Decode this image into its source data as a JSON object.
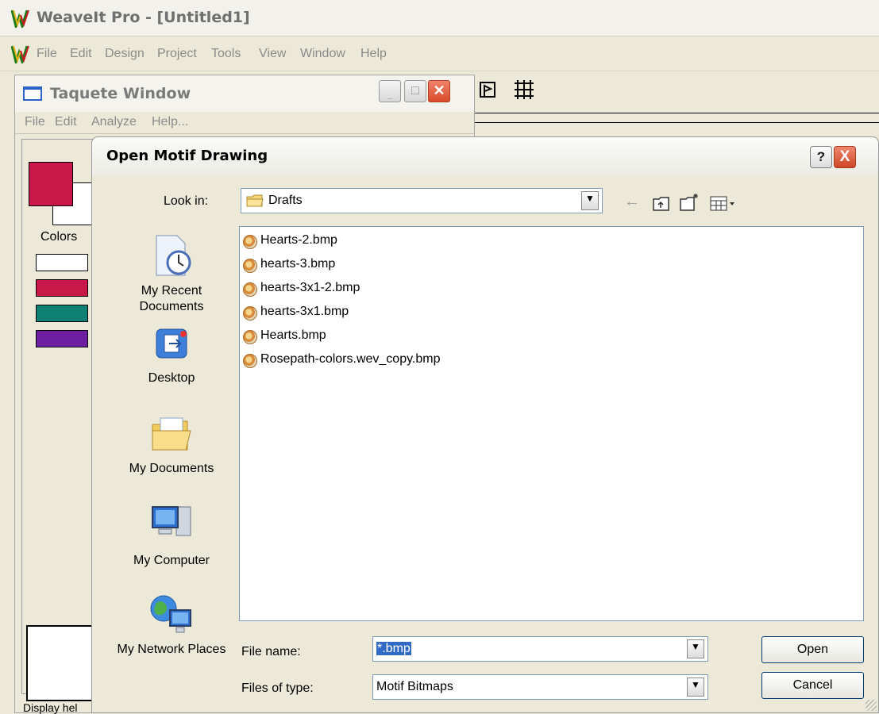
{
  "app": {
    "title": "WeaveIt Pro - [Untitled1]",
    "menu": [
      "File",
      "Edit",
      "Design",
      "Project",
      "Tools",
      "View",
      "Window",
      "Help"
    ]
  },
  "taquete": {
    "title": "Taquete Window",
    "menu": [
      "File",
      "Edit",
      "Analyze",
      "Help..."
    ],
    "colors_label": "Colors",
    "swatches": [
      "#ffffff",
      "#c8184a",
      "#0f8074",
      "#6e1fa1"
    ],
    "primary_color": "#c8184a",
    "secondary_color": "#ffffff",
    "status_text": "Display hel"
  },
  "dialog": {
    "title": "Open Motif Drawing",
    "help_glyph": "?",
    "close_glyph": "X",
    "look_in_label": "Look in:",
    "look_in_value": "Drafts",
    "places": [
      {
        "label": "My Recent Documents",
        "icon": "recent-documents-icon"
      },
      {
        "label": "Desktop",
        "icon": "desktop-icon"
      },
      {
        "label": "My Documents",
        "icon": "my-documents-icon"
      },
      {
        "label": "My Computer",
        "icon": "my-computer-icon"
      },
      {
        "label": "My Network Places",
        "icon": "network-places-icon"
      }
    ],
    "files": [
      "Hearts-2.bmp",
      "hearts-3.bmp",
      "hearts-3x1-2.bmp",
      "hearts-3x1.bmp",
      "Hearts.bmp",
      "Rosepath-colors.wev_copy.bmp"
    ],
    "file_name_label": "File name:",
    "file_name_value": "*.bmp",
    "files_of_type_label": "Files of type:",
    "files_of_type_value": "Motif Bitmaps",
    "open_button": "Open",
    "cancel_button": "Cancel"
  }
}
